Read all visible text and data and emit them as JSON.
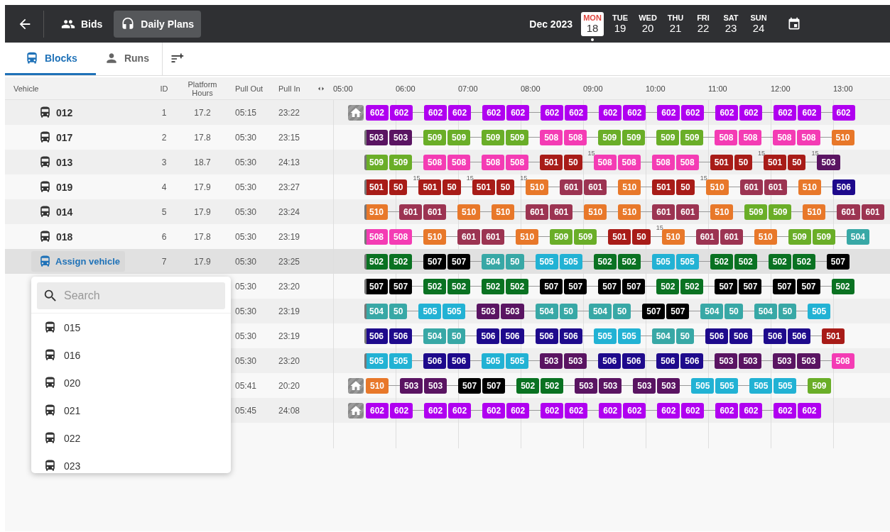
{
  "header": {
    "nav": [
      {
        "label": "Bids",
        "kind": "bids",
        "selected": false
      },
      {
        "label": "Daily Plans",
        "kind": "plans",
        "selected": true
      }
    ],
    "month": "Dec 2023",
    "days": [
      {
        "weekday": "MON",
        "date": "18",
        "selected": true
      },
      {
        "weekday": "TUE",
        "date": "19",
        "selected": false
      },
      {
        "weekday": "WED",
        "date": "20",
        "selected": false
      },
      {
        "weekday": "THU",
        "date": "21",
        "selected": false
      },
      {
        "weekday": "FRI",
        "date": "22",
        "selected": false
      },
      {
        "weekday": "SAT",
        "date": "23",
        "selected": false
      },
      {
        "weekday": "SUN",
        "date": "24",
        "selected": false
      }
    ]
  },
  "tabs": [
    {
      "label": "Blocks",
      "kind": "blocks",
      "selected": true
    },
    {
      "label": "Runs",
      "kind": "runs",
      "selected": false
    }
  ],
  "columns": [
    "Vehicle",
    "ID",
    "Platform Hours",
    "Pull Out",
    "Pull In"
  ],
  "hours": [
    "05:00",
    "06:00",
    "07:00",
    "08:00",
    "09:00",
    "10:00",
    "11:00",
    "12:00",
    "13:00"
  ],
  "rows": [
    {
      "vehicle": "012",
      "assigned": true,
      "id": "1",
      "platform_hours": "17.2",
      "pull_out": "05:15",
      "pull_in": "23:22",
      "selected": false,
      "depot": true,
      "groups": [
        {
          "trips": [
            {
              "label": "602",
              "color": "#b000f0"
            },
            {
              "label": "602",
              "color": "#b000f0"
            }
          ]
        },
        {
          "trips": [
            {
              "label": "602",
              "color": "#b000f0"
            },
            {
              "label": "602",
              "color": "#b000f0"
            }
          ]
        },
        {
          "trips": [
            {
              "label": "602",
              "color": "#b000f0"
            },
            {
              "label": "602",
              "color": "#b000f0"
            }
          ]
        },
        {
          "trips": [
            {
              "label": "602",
              "color": "#b000f0"
            },
            {
              "label": "602",
              "color": "#b000f0"
            }
          ]
        },
        {
          "trips": [
            {
              "label": "602",
              "color": "#b000f0"
            },
            {
              "label": "602",
              "color": "#b000f0"
            }
          ]
        },
        {
          "trips": [
            {
              "label": "602",
              "color": "#b000f0"
            },
            {
              "label": "602",
              "color": "#b000f0"
            }
          ]
        },
        {
          "trips": [
            {
              "label": "602",
              "color": "#b000f0"
            },
            {
              "label": "602",
              "color": "#b000f0"
            }
          ]
        },
        {
          "trips": [
            {
              "label": "602",
              "color": "#b000f0"
            },
            {
              "label": "602",
              "color": "#b000f0"
            }
          ]
        },
        {
          "trips": [
            {
              "label": "602",
              "color": "#b000f0"
            }
          ]
        }
      ]
    },
    {
      "vehicle": "017",
      "assigned": true,
      "id": "2",
      "platform_hours": "17.8",
      "pull_out": "05:30",
      "pull_in": "23:15",
      "selected": false,
      "depot": false,
      "groups": [
        {
          "trips": [
            {
              "label": "503",
              "color": "#5a1462"
            },
            {
              "label": "503",
              "color": "#5a1462"
            }
          ]
        },
        {
          "trips": [
            {
              "label": "509",
              "color": "#6aae28"
            },
            {
              "label": "509",
              "color": "#6aae28"
            }
          ]
        },
        {
          "trips": [
            {
              "label": "509",
              "color": "#6aae28"
            },
            {
              "label": "509",
              "color": "#6aae28"
            }
          ]
        },
        {
          "trips": [
            {
              "label": "508",
              "color": "#f43cb4"
            },
            {
              "label": "508",
              "color": "#f43cb4"
            }
          ]
        },
        {
          "trips": [
            {
              "label": "509",
              "color": "#6aae28"
            },
            {
              "label": "509",
              "color": "#6aae28"
            }
          ]
        },
        {
          "trips": [
            {
              "label": "509",
              "color": "#6aae28"
            },
            {
              "label": "509",
              "color": "#6aae28"
            }
          ]
        },
        {
          "trips": [
            {
              "label": "508",
              "color": "#f43cb4"
            },
            {
              "label": "508",
              "color": "#f43cb4"
            }
          ]
        },
        {
          "trips": [
            {
              "label": "508",
              "color": "#f43cb4"
            },
            {
              "label": "508",
              "color": "#f43cb4"
            }
          ]
        },
        {
          "trips": [
            {
              "label": "510",
              "color": "#e8782a"
            }
          ]
        }
      ]
    },
    {
      "vehicle": "013",
      "assigned": true,
      "id": "3",
      "platform_hours": "18.7",
      "pull_out": "05:30",
      "pull_in": "24:13",
      "selected": false,
      "depot": false,
      "groups": [
        {
          "trips": [
            {
              "label": "509",
              "color": "#6aae28"
            },
            {
              "label": "509",
              "color": "#6aae28"
            }
          ]
        },
        {
          "trips": [
            {
              "label": "508",
              "color": "#f43cb4"
            },
            {
              "label": "508",
              "color": "#f43cb4"
            }
          ]
        },
        {
          "trips": [
            {
              "label": "508",
              "color": "#f43cb4"
            },
            {
              "label": "508",
              "color": "#f43cb4"
            }
          ]
        },
        {
          "trips": [
            {
              "label": "501",
              "color": "#a81c18"
            },
            {
              "label": "50",
              "color": "#a81c18"
            }
          ],
          "layover": "15"
        },
        {
          "trips": [
            {
              "label": "508",
              "color": "#f43cb4"
            },
            {
              "label": "508",
              "color": "#f43cb4"
            }
          ]
        },
        {
          "trips": [
            {
              "label": "508",
              "color": "#f43cb4"
            },
            {
              "label": "508",
              "color": "#f43cb4"
            }
          ]
        },
        {
          "trips": [
            {
              "label": "501",
              "color": "#a81c18"
            },
            {
              "label": "50",
              "color": "#a81c18"
            }
          ],
          "layover": "15"
        },
        {
          "trips": [
            {
              "label": "501",
              "color": "#a81c18"
            },
            {
              "label": "50",
              "color": "#a81c18"
            }
          ],
          "layover": "15"
        },
        {
          "trips": [
            {
              "label": "503",
              "color": "#5a1462"
            }
          ]
        }
      ]
    },
    {
      "vehicle": "019",
      "assigned": true,
      "id": "4",
      "platform_hours": "17.9",
      "pull_out": "05:30",
      "pull_in": "23:27",
      "selected": false,
      "depot": false,
      "groups": [
        {
          "trips": [
            {
              "label": "501",
              "color": "#a81c18"
            },
            {
              "label": "50",
              "color": "#a81c18"
            }
          ],
          "layover": "15"
        },
        {
          "trips": [
            {
              "label": "501",
              "color": "#a81c18"
            },
            {
              "label": "50",
              "color": "#a81c18"
            }
          ],
          "layover": "15"
        },
        {
          "trips": [
            {
              "label": "501",
              "color": "#a81c18"
            },
            {
              "label": "50",
              "color": "#a81c18"
            }
          ],
          "layover": "15"
        },
        {
          "trips": [
            {
              "label": "510",
              "color": "#e8782a"
            }
          ]
        },
        {
          "trips": [
            {
              "label": "601",
              "color": "#9c3452"
            },
            {
              "label": "601",
              "color": "#9c3452"
            }
          ]
        },
        {
          "trips": [
            {
              "label": "510",
              "color": "#e8782a"
            }
          ]
        },
        {
          "trips": [
            {
              "label": "501",
              "color": "#a81c18"
            },
            {
              "label": "50",
              "color": "#a81c18"
            }
          ],
          "layover": "15"
        },
        {
          "trips": [
            {
              "label": "510",
              "color": "#e8782a"
            }
          ]
        },
        {
          "trips": [
            {
              "label": "601",
              "color": "#9c3452"
            },
            {
              "label": "601",
              "color": "#9c3452"
            }
          ]
        },
        {
          "trips": [
            {
              "label": "510",
              "color": "#e8782a"
            }
          ]
        },
        {
          "trips": [
            {
              "label": "506",
              "color": "#1e0a8c"
            }
          ]
        }
      ]
    },
    {
      "vehicle": "014",
      "assigned": true,
      "id": "5",
      "platform_hours": "17.9",
      "pull_out": "05:30",
      "pull_in": "23:24",
      "selected": false,
      "depot": false,
      "groups": [
        {
          "trips": [
            {
              "label": "510",
              "color": "#e8782a"
            }
          ]
        },
        {
          "trips": [
            {
              "label": "601",
              "color": "#9c3452"
            },
            {
              "label": "601",
              "color": "#9c3452"
            }
          ]
        },
        {
          "trips": [
            {
              "label": "510",
              "color": "#e8782a"
            }
          ]
        },
        {
          "trips": [
            {
              "label": "510",
              "color": "#e8782a"
            }
          ]
        },
        {
          "trips": [
            {
              "label": "601",
              "color": "#9c3452"
            },
            {
              "label": "601",
              "color": "#9c3452"
            }
          ]
        },
        {
          "trips": [
            {
              "label": "510",
              "color": "#e8782a"
            }
          ]
        },
        {
          "trips": [
            {
              "label": "510",
              "color": "#e8782a"
            }
          ]
        },
        {
          "trips": [
            {
              "label": "601",
              "color": "#9c3452"
            },
            {
              "label": "601",
              "color": "#9c3452"
            }
          ]
        },
        {
          "trips": [
            {
              "label": "510",
              "color": "#e8782a"
            }
          ]
        },
        {
          "trips": [
            {
              "label": "509",
              "color": "#6aae28"
            },
            {
              "label": "509",
              "color": "#6aae28"
            }
          ]
        },
        {
          "trips": [
            {
              "label": "510",
              "color": "#e8782a"
            }
          ]
        },
        {
          "trips": [
            {
              "label": "601",
              "color": "#9c3452"
            },
            {
              "label": "601",
              "color": "#9c3452"
            }
          ]
        }
      ]
    },
    {
      "vehicle": "018",
      "assigned": true,
      "id": "6",
      "platform_hours": "17.8",
      "pull_out": "05:30",
      "pull_in": "23:19",
      "selected": false,
      "depot": false,
      "groups": [
        {
          "trips": [
            {
              "label": "508",
              "color": "#f43cb4"
            },
            {
              "label": "508",
              "color": "#f43cb4"
            }
          ]
        },
        {
          "trips": [
            {
              "label": "510",
              "color": "#e8782a"
            }
          ]
        },
        {
          "trips": [
            {
              "label": "601",
              "color": "#9c3452"
            },
            {
              "label": "601",
              "color": "#9c3452"
            }
          ]
        },
        {
          "trips": [
            {
              "label": "510",
              "color": "#e8782a"
            }
          ]
        },
        {
          "trips": [
            {
              "label": "509",
              "color": "#6aae28"
            },
            {
              "label": "509",
              "color": "#6aae28"
            }
          ]
        },
        {
          "trips": [
            {
              "label": "501",
              "color": "#a81c18"
            },
            {
              "label": "50",
              "color": "#a81c18"
            }
          ],
          "layover": "15"
        },
        {
          "trips": [
            {
              "label": "510",
              "color": "#e8782a"
            }
          ]
        },
        {
          "trips": [
            {
              "label": "601",
              "color": "#9c3452"
            },
            {
              "label": "601",
              "color": "#9c3452"
            }
          ]
        },
        {
          "trips": [
            {
              "label": "510",
              "color": "#e8782a"
            }
          ]
        },
        {
          "trips": [
            {
              "label": "509",
              "color": "#6aae28"
            },
            {
              "label": "509",
              "color": "#6aae28"
            }
          ]
        },
        {
          "trips": [
            {
              "label": "504",
              "color": "#38a8a6"
            }
          ]
        }
      ]
    },
    {
      "vehicle": "Assign vehicle",
      "assigned": false,
      "id": "7",
      "platform_hours": "17.9",
      "pull_out": "05:30",
      "pull_in": "23:25",
      "selected": true,
      "depot": false,
      "groups": [
        {
          "trips": [
            {
              "label": "502",
              "color": "#0a7222"
            },
            {
              "label": "502",
              "color": "#0a7222"
            }
          ]
        },
        {
          "trips": [
            {
              "label": "507",
              "color": "#000000"
            },
            {
              "label": "507",
              "color": "#000000"
            }
          ]
        },
        {
          "trips": [
            {
              "label": "504",
              "color": "#38a8a6"
            },
            {
              "label": "50",
              "color": "#38a8a6"
            }
          ]
        },
        {
          "trips": [
            {
              "label": "505",
              "color": "#22b2d4"
            },
            {
              "label": "505",
              "color": "#22b2d4"
            }
          ]
        },
        {
          "trips": [
            {
              "label": "502",
              "color": "#0a7222"
            },
            {
              "label": "502",
              "color": "#0a7222"
            }
          ]
        },
        {
          "trips": [
            {
              "label": "505",
              "color": "#22b2d4"
            },
            {
              "label": "505",
              "color": "#22b2d4"
            }
          ]
        },
        {
          "trips": [
            {
              "label": "502",
              "color": "#0a7222"
            },
            {
              "label": "502",
              "color": "#0a7222"
            }
          ]
        },
        {
          "trips": [
            {
              "label": "502",
              "color": "#0a7222"
            },
            {
              "label": "502",
              "color": "#0a7222"
            }
          ]
        },
        {
          "trips": [
            {
              "label": "507",
              "color": "#000000"
            }
          ]
        }
      ]
    },
    {
      "pull_out": "05:30",
      "pull_in": "23:20",
      "selected": false,
      "depot": false,
      "groups": [
        {
          "trips": [
            {
              "label": "507",
              "color": "#000000"
            },
            {
              "label": "507",
              "color": "#000000"
            }
          ]
        },
        {
          "trips": [
            {
              "label": "502",
              "color": "#0a7222"
            },
            {
              "label": "502",
              "color": "#0a7222"
            }
          ]
        },
        {
          "trips": [
            {
              "label": "502",
              "color": "#0a7222"
            },
            {
              "label": "502",
              "color": "#0a7222"
            }
          ]
        },
        {
          "trips": [
            {
              "label": "507",
              "color": "#000000"
            },
            {
              "label": "507",
              "color": "#000000"
            }
          ]
        },
        {
          "trips": [
            {
              "label": "507",
              "color": "#000000"
            },
            {
              "label": "507",
              "color": "#000000"
            }
          ]
        },
        {
          "trips": [
            {
              "label": "502",
              "color": "#0a7222"
            },
            {
              "label": "502",
              "color": "#0a7222"
            }
          ]
        },
        {
          "trips": [
            {
              "label": "507",
              "color": "#000000"
            },
            {
              "label": "507",
              "color": "#000000"
            }
          ]
        },
        {
          "trips": [
            {
              "label": "507",
              "color": "#000000"
            },
            {
              "label": "507",
              "color": "#000000"
            }
          ]
        },
        {
          "trips": [
            {
              "label": "502",
              "color": "#0a7222"
            }
          ]
        }
      ]
    },
    {
      "pull_out": "05:30",
      "pull_in": "23:19",
      "selected": false,
      "depot": false,
      "groups": [
        {
          "trips": [
            {
              "label": "504",
              "color": "#38a8a6"
            },
            {
              "label": "50",
              "color": "#38a8a6"
            }
          ]
        },
        {
          "trips": [
            {
              "label": "505",
              "color": "#22b2d4"
            },
            {
              "label": "505",
              "color": "#22b2d4"
            }
          ]
        },
        {
          "trips": [
            {
              "label": "503",
              "color": "#5a1462"
            },
            {
              "label": "503",
              "color": "#5a1462"
            }
          ]
        },
        {
          "trips": [
            {
              "label": "504",
              "color": "#38a8a6"
            },
            {
              "label": "50",
              "color": "#38a8a6"
            }
          ]
        },
        {
          "trips": [
            {
              "label": "504",
              "color": "#38a8a6"
            },
            {
              "label": "50",
              "color": "#38a8a6"
            }
          ]
        },
        {
          "trips": [
            {
              "label": "507",
              "color": "#000000"
            },
            {
              "label": "507",
              "color": "#000000"
            }
          ]
        },
        {
          "trips": [
            {
              "label": "504",
              "color": "#38a8a6"
            },
            {
              "label": "50",
              "color": "#38a8a6"
            }
          ]
        },
        {
          "trips": [
            {
              "label": "504",
              "color": "#38a8a6"
            },
            {
              "label": "50",
              "color": "#38a8a6"
            }
          ]
        },
        {
          "trips": [
            {
              "label": "505",
              "color": "#22b2d4"
            }
          ]
        }
      ]
    },
    {
      "pull_out": "05:30",
      "pull_in": "23:19",
      "selected": false,
      "depot": false,
      "groups": [
        {
          "trips": [
            {
              "label": "506",
              "color": "#1e0a8c"
            },
            {
              "label": "506",
              "color": "#1e0a8c"
            }
          ]
        },
        {
          "trips": [
            {
              "label": "504",
              "color": "#38a8a6"
            },
            {
              "label": "50",
              "color": "#38a8a6"
            }
          ]
        },
        {
          "trips": [
            {
              "label": "506",
              "color": "#1e0a8c"
            },
            {
              "label": "506",
              "color": "#1e0a8c"
            }
          ]
        },
        {
          "trips": [
            {
              "label": "506",
              "color": "#1e0a8c"
            },
            {
              "label": "506",
              "color": "#1e0a8c"
            }
          ]
        },
        {
          "trips": [
            {
              "label": "505",
              "color": "#22b2d4"
            },
            {
              "label": "505",
              "color": "#22b2d4"
            }
          ]
        },
        {
          "trips": [
            {
              "label": "504",
              "color": "#38a8a6"
            },
            {
              "label": "50",
              "color": "#38a8a6"
            }
          ]
        },
        {
          "trips": [
            {
              "label": "506",
              "color": "#1e0a8c"
            },
            {
              "label": "506",
              "color": "#1e0a8c"
            }
          ]
        },
        {
          "trips": [
            {
              "label": "506",
              "color": "#1e0a8c"
            },
            {
              "label": "506",
              "color": "#1e0a8c"
            }
          ]
        },
        {
          "trips": [
            {
              "label": "501",
              "color": "#a81c18"
            }
          ]
        }
      ]
    },
    {
      "pull_out": "05:30",
      "pull_in": "23:20",
      "selected": false,
      "depot": false,
      "groups": [
        {
          "trips": [
            {
              "label": "505",
              "color": "#22b2d4"
            },
            {
              "label": "505",
              "color": "#22b2d4"
            }
          ]
        },
        {
          "trips": [
            {
              "label": "506",
              "color": "#1e0a8c"
            },
            {
              "label": "506",
              "color": "#1e0a8c"
            }
          ]
        },
        {
          "trips": [
            {
              "label": "505",
              "color": "#22b2d4"
            },
            {
              "label": "505",
              "color": "#22b2d4"
            }
          ]
        },
        {
          "trips": [
            {
              "label": "503",
              "color": "#5a1462"
            },
            {
              "label": "503",
              "color": "#5a1462"
            }
          ]
        },
        {
          "trips": [
            {
              "label": "506",
              "color": "#1e0a8c"
            },
            {
              "label": "506",
              "color": "#1e0a8c"
            }
          ]
        },
        {
          "trips": [
            {
              "label": "506",
              "color": "#1e0a8c"
            },
            {
              "label": "506",
              "color": "#1e0a8c"
            }
          ]
        },
        {
          "trips": [
            {
              "label": "503",
              "color": "#5a1462"
            },
            {
              "label": "503",
              "color": "#5a1462"
            }
          ]
        },
        {
          "trips": [
            {
              "label": "503",
              "color": "#5a1462"
            },
            {
              "label": "503",
              "color": "#5a1462"
            }
          ]
        },
        {
          "trips": [
            {
              "label": "508",
              "color": "#f43cb4"
            }
          ]
        }
      ]
    },
    {
      "pull_out": "05:41",
      "pull_in": "20:20",
      "selected": false,
      "depot": true,
      "groups": [
        {
          "trips": [
            {
              "label": "510",
              "color": "#e8782a"
            }
          ]
        },
        {
          "trips": [
            {
              "label": "503",
              "color": "#5a1462"
            },
            {
              "label": "503",
              "color": "#5a1462"
            }
          ]
        },
        {
          "trips": [
            {
              "label": "507",
              "color": "#000000"
            },
            {
              "label": "507",
              "color": "#000000"
            }
          ]
        },
        {
          "trips": [
            {
              "label": "502",
              "color": "#0a7222"
            },
            {
              "label": "502",
              "color": "#0a7222"
            }
          ]
        },
        {
          "trips": [
            {
              "label": "503",
              "color": "#5a1462"
            },
            {
              "label": "503",
              "color": "#5a1462"
            }
          ]
        },
        {
          "trips": [
            {
              "label": "503",
              "color": "#5a1462"
            },
            {
              "label": "503",
              "color": "#5a1462"
            }
          ]
        },
        {
          "trips": [
            {
              "label": "505",
              "color": "#22b2d4"
            },
            {
              "label": "505",
              "color": "#22b2d4"
            }
          ]
        },
        {
          "trips": [
            {
              "label": "505",
              "color": "#22b2d4"
            },
            {
              "label": "505",
              "color": "#22b2d4"
            }
          ]
        },
        {
          "trips": [
            {
              "label": "509",
              "color": "#6aae28"
            }
          ]
        }
      ]
    },
    {
      "pull_out": "05:45",
      "pull_in": "24:08",
      "selected": false,
      "depot": true,
      "groups": [
        {
          "trips": [
            {
              "label": "602",
              "color": "#b000f0"
            },
            {
              "label": "602",
              "color": "#b000f0"
            }
          ]
        },
        {
          "trips": [
            {
              "label": "602",
              "color": "#b000f0"
            },
            {
              "label": "602",
              "color": "#b000f0"
            }
          ]
        },
        {
          "trips": [
            {
              "label": "602",
              "color": "#b000f0"
            },
            {
              "label": "602",
              "color": "#b000f0"
            }
          ]
        },
        {
          "trips": [
            {
              "label": "602",
              "color": "#b000f0"
            },
            {
              "label": "602",
              "color": "#b000f0"
            }
          ]
        },
        {
          "trips": [
            {
              "label": "602",
              "color": "#b000f0"
            },
            {
              "label": "602",
              "color": "#b000f0"
            }
          ]
        },
        {
          "trips": [
            {
              "label": "602",
              "color": "#b000f0"
            },
            {
              "label": "602",
              "color": "#b000f0"
            }
          ]
        },
        {
          "trips": [
            {
              "label": "602",
              "color": "#b000f0"
            },
            {
              "label": "602",
              "color": "#b000f0"
            }
          ]
        },
        {
          "trips": [
            {
              "label": "602",
              "color": "#b000f0"
            },
            {
              "label": "602",
              "color": "#b000f0"
            }
          ]
        }
      ]
    }
  ],
  "vehicle_menu": {
    "placeholder": "Search",
    "items": [
      "015",
      "016",
      "020",
      "021",
      "022",
      "023"
    ]
  }
}
